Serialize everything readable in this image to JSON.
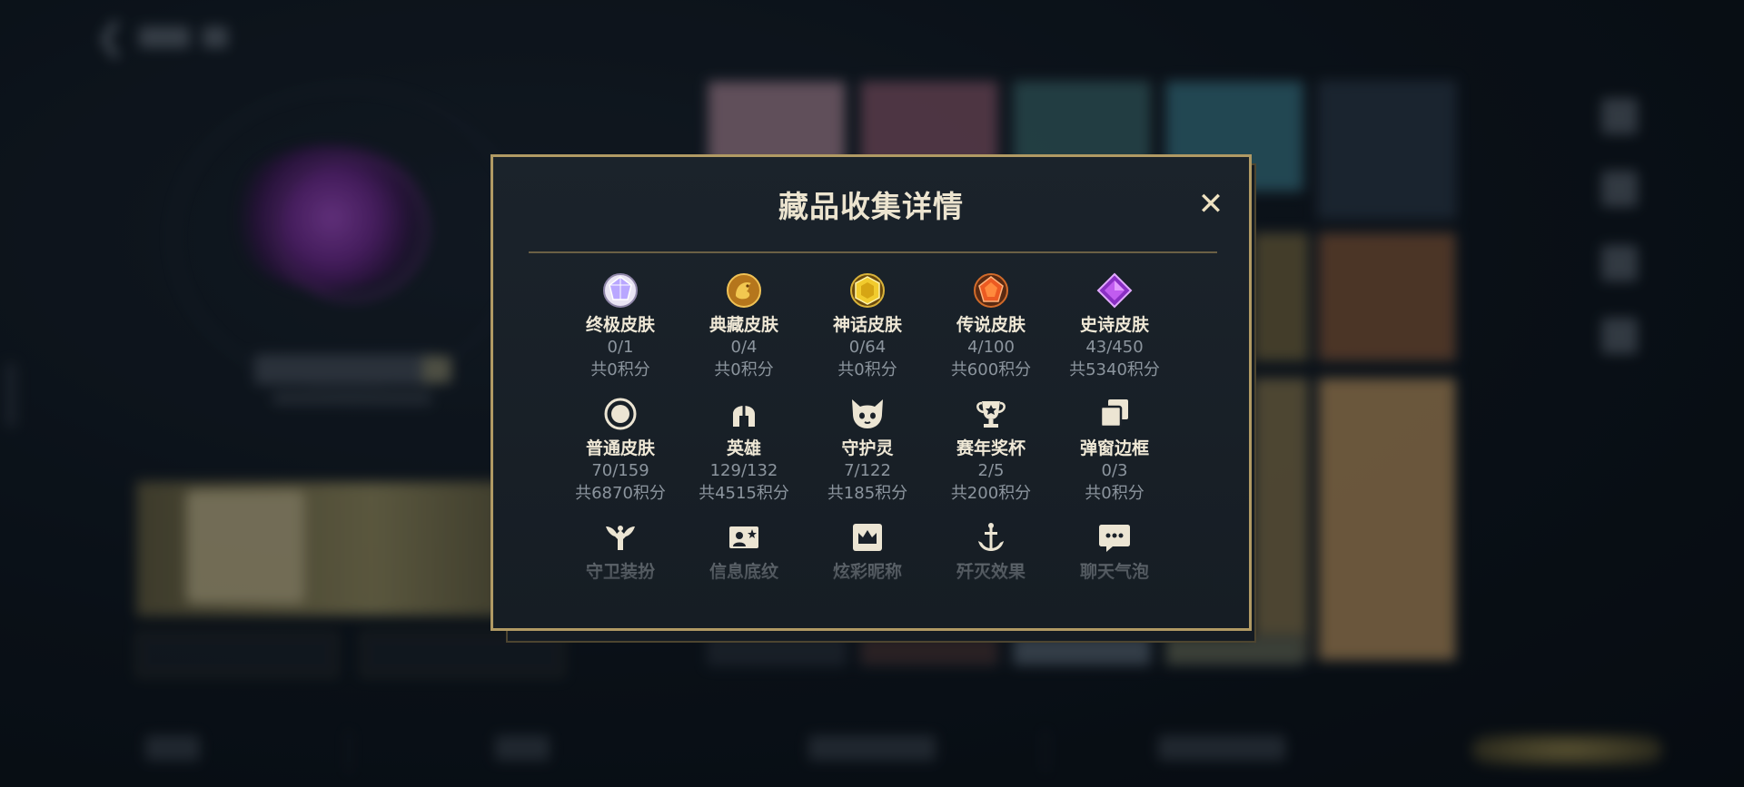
{
  "modal": {
    "title": "藏品收集详情",
    "close_symbol": "✕",
    "categories": [
      {
        "name": "终极皮肤",
        "count": "0/1",
        "points": "共0积分",
        "icon": "ultimate-skin-icon",
        "color": "#c9b9ff"
      },
      {
        "name": "典藏皮肤",
        "count": "0/4",
        "points": "共0积分",
        "icon": "prestige-skin-icon",
        "color": "#d9a33a"
      },
      {
        "name": "神话皮肤",
        "count": "0/64",
        "points": "共0积分",
        "icon": "mythic-skin-icon",
        "color": "#e8c232"
      },
      {
        "name": "传说皮肤",
        "count": "4/100",
        "points": "共600积分",
        "icon": "legendary-skin-icon",
        "color": "#e8642a"
      },
      {
        "name": "史诗皮肤",
        "count": "43/450",
        "points": "共5340积分",
        "icon": "epic-skin-icon",
        "color": "#a84ad8"
      },
      {
        "name": "普通皮肤",
        "count": "70/159",
        "points": "共6870积分",
        "icon": "common-skin-icon",
        "color": "#e6dfd0"
      },
      {
        "name": "英雄",
        "count": "129/132",
        "points": "共4515积分",
        "icon": "champion-helmet-icon",
        "color": "#e6dfd0"
      },
      {
        "name": "守护灵",
        "count": "7/122",
        "points": "共185积分",
        "icon": "guardian-spirit-icon",
        "color": "#e6dfd0"
      },
      {
        "name": "赛年奖杯",
        "count": "2/5",
        "points": "共200积分",
        "icon": "season-trophy-icon",
        "color": "#e6dfd0"
      },
      {
        "name": "弹窗边框",
        "count": "0/3",
        "points": "共0积分",
        "icon": "popup-frame-icon",
        "color": "#e6dfd0"
      },
      {
        "name": "守卫装扮",
        "icon": "ward-skin-icon",
        "color": "#e6dfd0"
      },
      {
        "name": "信息底纹",
        "icon": "profile-banner-icon",
        "color": "#e6dfd0"
      },
      {
        "name": "炫彩昵称",
        "icon": "colored-nickname-icon",
        "color": "#e6dfd0"
      },
      {
        "name": "歼灭效果",
        "icon": "elimination-effect-icon",
        "color": "#e6dfd0"
      },
      {
        "name": "聊天气泡",
        "icon": "chat-bubble-icon",
        "color": "#e6dfd0"
      }
    ]
  },
  "colors": {
    "modal_border": "#b19a64",
    "title": "#ece4cf",
    "muted_text": "#8c959e",
    "divider": "#6b6045"
  }
}
